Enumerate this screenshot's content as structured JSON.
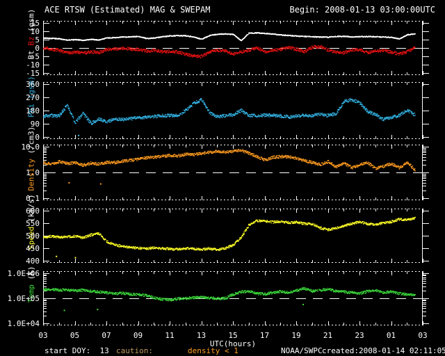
{
  "header": {
    "title": "ACE RTSW (Estimated) MAG & SWEPAM",
    "begin_label": "Begin: 2008-01-13 03:00:00UTC"
  },
  "footer": {
    "start_doy": "start DOY:  13",
    "caution_label": "caution:",
    "caution_value": "density < 1",
    "agency": "NOAA/SWPC",
    "created": "created:2008-01-14 02:11:05UTC"
  },
  "colors": {
    "background": "#000000",
    "frame": "#ffffff",
    "bt": "#ffffff",
    "bz": "#e81212",
    "phi": "#35b6e8",
    "density": "#ff9c20",
    "speed": "#ffff28",
    "temp": "#3ddc3d",
    "caution_text": "#c09860"
  },
  "x_axis": {
    "label": "UTC(hours)",
    "tick_labels": [
      "03",
      "05",
      "07",
      "09",
      "11",
      "13",
      "15",
      "17",
      "19",
      "21",
      "23",
      "01",
      "03"
    ],
    "tick_hours": [
      3,
      5,
      7,
      9,
      11,
      13,
      15,
      17,
      19,
      21,
      23,
      25,
      27
    ],
    "start_hour": 3,
    "end_hour": 27
  },
  "chart_data": {
    "type": "scatter",
    "title": "ACE RTSW (Estimated) MAG & SWEPAM",
    "x_hours": [
      3.0,
      3.5,
      4.0,
      4.5,
      5.0,
      5.5,
      6.0,
      6.5,
      7.0,
      7.5,
      8.0,
      8.5,
      9.0,
      9.5,
      10.0,
      10.5,
      11.0,
      11.5,
      12.0,
      12.5,
      13.0,
      13.5,
      14.0,
      14.5,
      15.0,
      15.5,
      16.0,
      16.5,
      17.0,
      17.5,
      18.0,
      18.5,
      19.0,
      19.5,
      20.0,
      20.5,
      21.0,
      21.5,
      22.0,
      22.5,
      23.0,
      23.5,
      24.0,
      24.5,
      25.0,
      25.5,
      26.0,
      26.5
    ],
    "panels": [
      {
        "name": "mag",
        "scale": "linear",
        "ylim": [
          -15,
          15
        ],
        "ytick_values": [
          15,
          10,
          5,
          0,
          -5,
          -10,
          -15
        ],
        "ytick_labels": [
          "15",
          "10",
          "5",
          "0",
          "-5",
          "-10",
          "-15"
        ],
        "dashed_y": 0,
        "ylabel_parts": [
          {
            "text": "Bt ",
            "color": "#ffffff"
          },
          {
            "text": "Bz",
            "color": "#e81212"
          },
          {
            "text": " (gsm)",
            "color": "#ffffff"
          }
        ],
        "series": [
          {
            "name": "Bt",
            "color": "#ffffff",
            "noise": 0.25,
            "values": [
              6.2,
              6.0,
              5.8,
              5.0,
              5.3,
              4.8,
              5.5,
              5.0,
              6.3,
              6.5,
              6.8,
              7.0,
              7.2,
              6.0,
              6.3,
              7.0,
              7.5,
              7.7,
              7.6,
              6.8,
              5.5,
              7.8,
              8.5,
              8.7,
              8.3,
              4.7,
              9.2,
              9.3,
              9.0,
              8.6,
              8.1,
              7.8,
              7.4,
              7.2,
              7.0,
              6.8,
              6.8,
              7.2,
              7.2,
              6.9,
              7.0,
              7.1,
              7.0,
              6.9,
              6.6,
              5.7,
              8.2,
              8.7
            ],
            "outliers": []
          },
          {
            "name": "Bz",
            "color": "#e81212",
            "noise": 0.9,
            "values": [
              0.5,
              -0.5,
              -1.0,
              -2.8,
              -2.2,
              -2.8,
              -2.0,
              -2.5,
              -0.5,
              -0.3,
              0.2,
              -0.3,
              -0.5,
              -1.5,
              -1.0,
              -2.0,
              -1.8,
              -2.2,
              -3.5,
              -4.5,
              -4.8,
              -2.0,
              -1.0,
              -1.5,
              -3.5,
              -2.0,
              -1.0,
              0.5,
              -2.0,
              -1.2,
              -0.5,
              0.5,
              -0.5,
              -2.0,
              0.8,
              1.2,
              -1.0,
              -2.2,
              -2.5,
              -1.0,
              -0.5,
              -2.5,
              -1.5,
              -1.2,
              -2.2,
              -3.3,
              -2.0,
              0.5
            ],
            "outliers": []
          }
        ]
      },
      {
        "name": "phi",
        "scale": "linear",
        "ylim": [
          0,
          360
        ],
        "ytick_values": [
          360,
          270,
          180,
          90,
          0
        ],
        "ytick_labels": [
          "360",
          "270",
          "180",
          "90",
          "0"
        ],
        "dashed_y": null,
        "ylabel_parts": [
          {
            "text": "Phi (gsm)",
            "color": "#35b6e8"
          }
        ],
        "series": [
          {
            "name": "Phi",
            "color": "#35b6e8",
            "noise": 11,
            "values": [
              145,
              150,
              148,
              220,
              100,
              165,
              95,
              125,
              105,
              128,
              122,
              128,
              132,
              138,
              142,
              148,
              150,
              148,
              185,
              230,
              260,
              170,
              140,
              148,
              155,
              185,
              150,
              150,
              152,
              150,
              146,
              140,
              143,
              152,
              148,
              158,
              150,
              163,
              245,
              258,
              235,
              175,
              158,
              122,
              138,
              152,
              185,
              152
            ],
            "outliers": [
              [
                5.2,
                15
              ]
            ]
          }
        ]
      },
      {
        "name": "density",
        "scale": "log",
        "ylim": [
          0.1,
          10
        ],
        "ytick_values": [
          10,
          1,
          0.1
        ],
        "ytick_labels": [
          "10.0",
          "1.0",
          "0.1"
        ],
        "dashed_y": 1.0,
        "ylabel_parts": [
          {
            "text": "Density",
            "color": "#ff9c20"
          },
          {
            "text": " (/cm3)",
            "color": "#ffffff"
          }
        ],
        "series": [
          {
            "name": "Density",
            "color": "#ff9c20",
            "noise": 0.055,
            "values": [
              2.5,
              2.2,
              2.7,
              2.3,
              2.5,
              2.0,
              2.4,
              2.2,
              2.6,
              2.5,
              2.9,
              3.1,
              3.4,
              3.9,
              4.1,
              4.4,
              4.8,
              4.6,
              5.3,
              5.1,
              5.8,
              6.3,
              6.8,
              6.4,
              6.9,
              7.6,
              5.8,
              4.2,
              3.2,
              4.0,
              4.3,
              4.2,
              3.7,
              3.0,
              2.5,
              2.1,
              2.7,
              1.7,
              2.4,
              1.6,
              2.1,
              2.5,
              1.5,
              1.8,
              2.3,
              1.6,
              2.5,
              1.3
            ],
            "outliers": [
              [
                4.6,
                0.42
              ],
              [
                6.6,
                0.38
              ]
            ]
          }
        ]
      },
      {
        "name": "speed",
        "scale": "linear",
        "ylim": [
          400,
          600
        ],
        "ytick_values": [
          600,
          550,
          500,
          450,
          400
        ],
        "ytick_labels": [
          "600",
          "550",
          "500",
          "450",
          "400"
        ],
        "dashed_y": null,
        "ylabel_parts": [
          {
            "text": "Speed",
            "color": "#ffff28"
          },
          {
            "text": " (km/s)",
            "color": "#ffffff"
          }
        ],
        "series": [
          {
            "name": "Speed",
            "color": "#ffff28",
            "noise": 4.5,
            "values": [
              495,
              500,
              496,
              498,
              500,
              494,
              505,
              512,
              478,
              465,
              460,
              455,
              452,
              450,
              454,
              451,
              449,
              448,
              451,
              449,
              447,
              451,
              445,
              452,
              465,
              495,
              545,
              562,
              560,
              556,
              558,
              554,
              556,
              550,
              548,
              533,
              526,
              532,
              542,
              550,
              558,
              549,
              546,
              553,
              558,
              568,
              565,
              573
            ],
            "outliers": [
              [
                3.8,
                420
              ],
              [
                5.0,
                415
              ]
            ]
          }
        ]
      },
      {
        "name": "temp",
        "scale": "log",
        "ylim": [
          10000,
          1000000
        ],
        "ytick_values": [
          1000000,
          100000,
          10000
        ],
        "ytick_labels": [
          "1.0E+06",
          "1.0E+05",
          "1.0E+04"
        ],
        "dashed_y": 100000,
        "ylabel_parts": [
          {
            "text": "Temp",
            "color": "#3ddc3d"
          },
          {
            "text": " (K)",
            "color": "#ffffff"
          }
        ],
        "series": [
          {
            "name": "Temp",
            "color": "#3ddc3d",
            "noise": 0.05,
            "values": [
              230000,
              240000,
              220000,
              230000,
              210000,
              220000,
              200000,
              190000,
              175000,
              160000,
              170000,
              150000,
              145000,
              135000,
              110000,
              95000,
              90000,
              100000,
              105000,
              110000,
              115000,
              110000,
              100000,
              105000,
              150000,
              190000,
              200000,
              160000,
              155000,
              175000,
              195000,
              175000,
              210000,
              260000,
              200000,
              220000,
              240000,
              200000,
              190000,
              175000,
              160000,
              200000,
              220000,
              180000,
              190000,
              160000,
              150000,
              135000
            ],
            "outliers": [
              [
                4.3,
                35000
              ],
              [
                6.4,
                38000
              ],
              [
                19.4,
                60000
              ]
            ]
          }
        ]
      }
    ]
  }
}
